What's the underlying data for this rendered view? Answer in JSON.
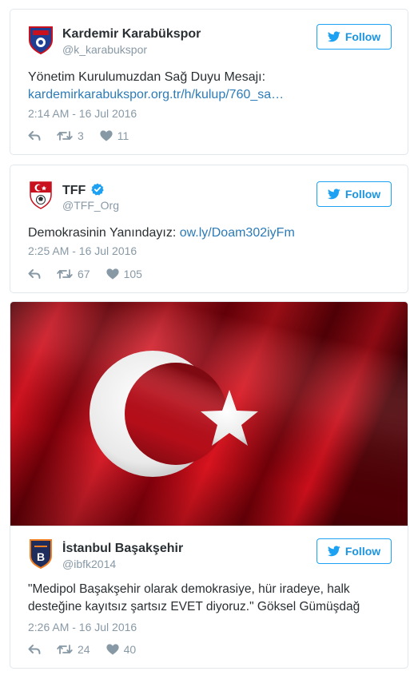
{
  "tweets": [
    {
      "name": "Kardemir Karabükspor",
      "handle": "@k_karabukspor",
      "verified": false,
      "text": "Yönetim Kurulumuzdan Sağ Duyu Mesajı:",
      "link": "kardemirkarabukspor.org.tr/h/kulup/760_sa…",
      "date": "2:14 AM - 16 Jul 2016",
      "retweets": "3",
      "likes": "11",
      "follow_label": "Follow"
    },
    {
      "name": "TFF",
      "handle": "@TFF_Org",
      "verified": true,
      "text": "Demokrasinin Yanındayız:",
      "link": "ow.ly/Doam302iyFm",
      "date": "2:25 AM - 16 Jul 2016",
      "retweets": "67",
      "likes": "105",
      "follow_label": "Follow"
    },
    {
      "name": "İstanbul Başakşehir",
      "handle": "@ibfk2014",
      "verified": false,
      "text_line1": "\"Medipol Başakşehir olarak demokrasiye, hür iradeye, halk",
      "text_line2": "desteğine kayıtsız şartsız EVET diyoruz.\" Göksel Gümüşdağ",
      "date": "2:26 AM - 16 Jul 2016",
      "retweets": "24",
      "likes": "40",
      "follow_label": "Follow",
      "media": "turkish-flag"
    }
  ],
  "colors": {
    "accent": "#1da1f2",
    "link": "#2b7bb9",
    "muted": "#8899a6",
    "border": "#e1e8ed",
    "flag_red": "#c8101e"
  },
  "icons": [
    "reply-icon",
    "retweet-icon",
    "heart-icon",
    "twitter-bird-icon",
    "verified-icon"
  ]
}
